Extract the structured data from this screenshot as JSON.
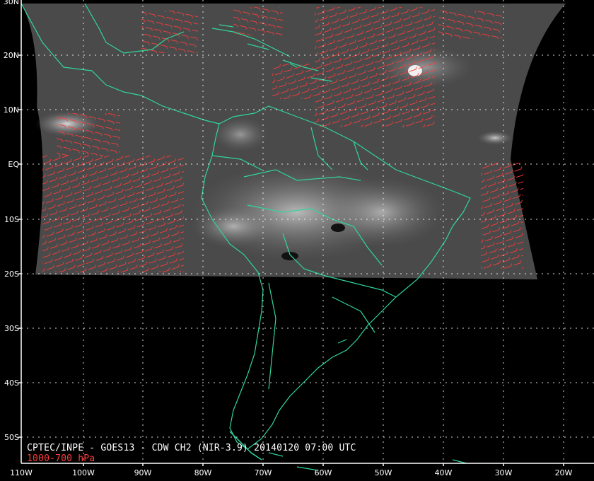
{
  "caption": {
    "line1": "CPTEC/INPE - GOES13 - CDW CH2 (NIR-3.9) 20140120 07:00 UTC",
    "line2": "1000-700 hPa"
  },
  "axes": {
    "lat_labels": [
      "30N",
      "20N",
      "10N",
      "EQ",
      "10S",
      "20S",
      "30S",
      "40S",
      "50S"
    ],
    "lon_labels": [
      "110W",
      "100W",
      "90W",
      "80W",
      "70W",
      "60W",
      "50W",
      "40W",
      "30W",
      "20W"
    ]
  },
  "colors": {
    "coastline": "#2fd69a",
    "wind_vectors": "#ff3b3b",
    "grid": "#ffffff",
    "background": "#000000"
  }
}
